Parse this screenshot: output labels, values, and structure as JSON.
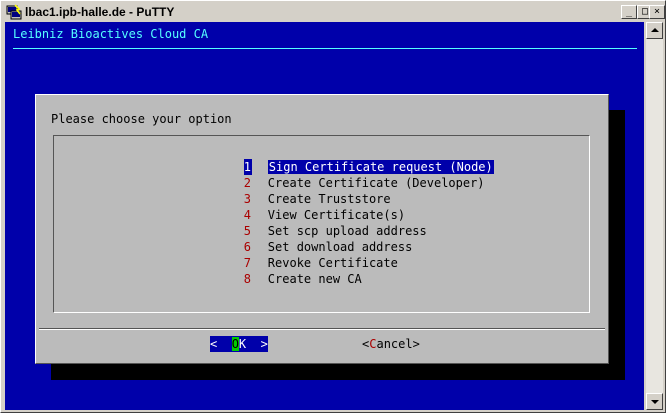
{
  "window": {
    "title": "lbac1.ipb-halle.de - PuTTY",
    "minimize_glyph": "_",
    "maximize_glyph": "□",
    "close_glyph": "×"
  },
  "terminal": {
    "header": "Leibniz Bioactives Cloud CA"
  },
  "dialog": {
    "prompt": "Please choose your option",
    "items": [
      {
        "num": "1",
        "label": "Sign Certificate request (Node)",
        "selected": true
      },
      {
        "num": "2",
        "label": "Create Certificate (Developer)",
        "selected": false
      },
      {
        "num": "3",
        "label": "Create Truststore",
        "selected": false
      },
      {
        "num": "4",
        "label": "View Certificate(s)",
        "selected": false
      },
      {
        "num": "5",
        "label": "Set scp upload address",
        "selected": false
      },
      {
        "num": "6",
        "label": "Set download address",
        "selected": false
      },
      {
        "num": "7",
        "label": "Revoke Certificate",
        "selected": false
      },
      {
        "num": "8",
        "label": "Create new CA",
        "selected": false
      }
    ],
    "ok": {
      "pre": "<  ",
      "hot": "O",
      "post": "K  >"
    },
    "cancel": {
      "pre": "<",
      "hot": "C",
      "post": "ancel>"
    }
  },
  "colors": {
    "terminal_bg": "#0000aa",
    "header_text": "#55ffff",
    "dialog_bg": "#bbbbbb",
    "selection_bg": "#0000aa",
    "hotkey": "#aa0000",
    "ok_hotkey_bg": "#00cc00"
  },
  "icons": [
    "putty-icon",
    "minimize-icon",
    "maximize-icon",
    "close-icon",
    "scroll-up-icon",
    "scroll-down-icon"
  ]
}
